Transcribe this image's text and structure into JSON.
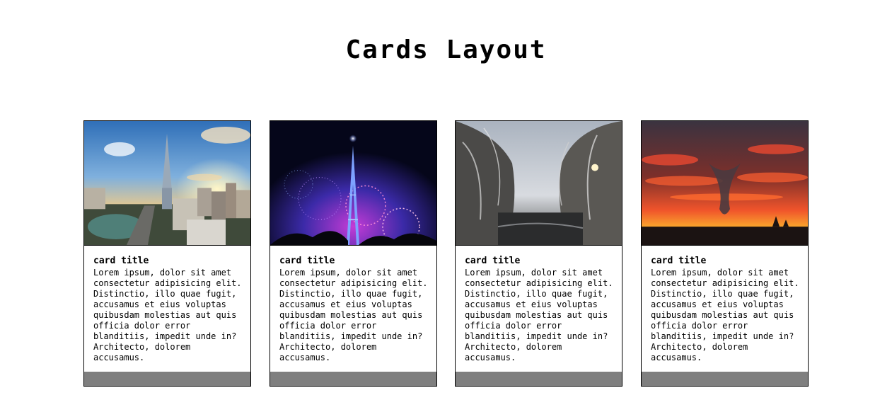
{
  "page": {
    "title": "Cards Layout"
  },
  "cards": [
    {
      "image": "city-skyline-sunset-photo",
      "title": "card title",
      "text": "Lorem ipsum, dolor sit amet consectetur adipisicing elit. Distinctio, illo quae fugit, accusamus et eius voluptas quibusdam molestias aut quis officia dolor error blanditiis, impedit unde in? Architecto, dolorem accusamus."
    },
    {
      "image": "eiffel-tower-fireworks-photo",
      "title": "card title",
      "text": "Lorem ipsum, dolor sit amet consectetur adipisicing elit. Distinctio, illo quae fugit, accusamus et eius voluptas quibusdam molestias aut quis officia dolor error blanditiis, impedit unde in? Architecto, dolorem accusamus."
    },
    {
      "image": "snowy-forest-river-photo",
      "title": "card title",
      "text": "Lorem ipsum, dolor sit amet consectetur adipisicing elit. Distinctio, illo quae fugit, accusamus et eius voluptas quibusdam molestias aut quis officia dolor error blanditiis, impedit unde in? Architecto, dolorem accusamus."
    },
    {
      "image": "red-sunset-sky-photo",
      "title": "card title",
      "text": "Lorem ipsum, dolor sit amet consectetur adipisicing elit. Distinctio, illo quae fugit, accusamus et eius voluptas quibusdam molestias aut quis officia dolor error blanditiis, impedit unde in? Architecto, dolorem accusamus."
    }
  ],
  "colors": {
    "footer": "#7f7f7f",
    "border": "#000000",
    "background": "#ffffff"
  }
}
